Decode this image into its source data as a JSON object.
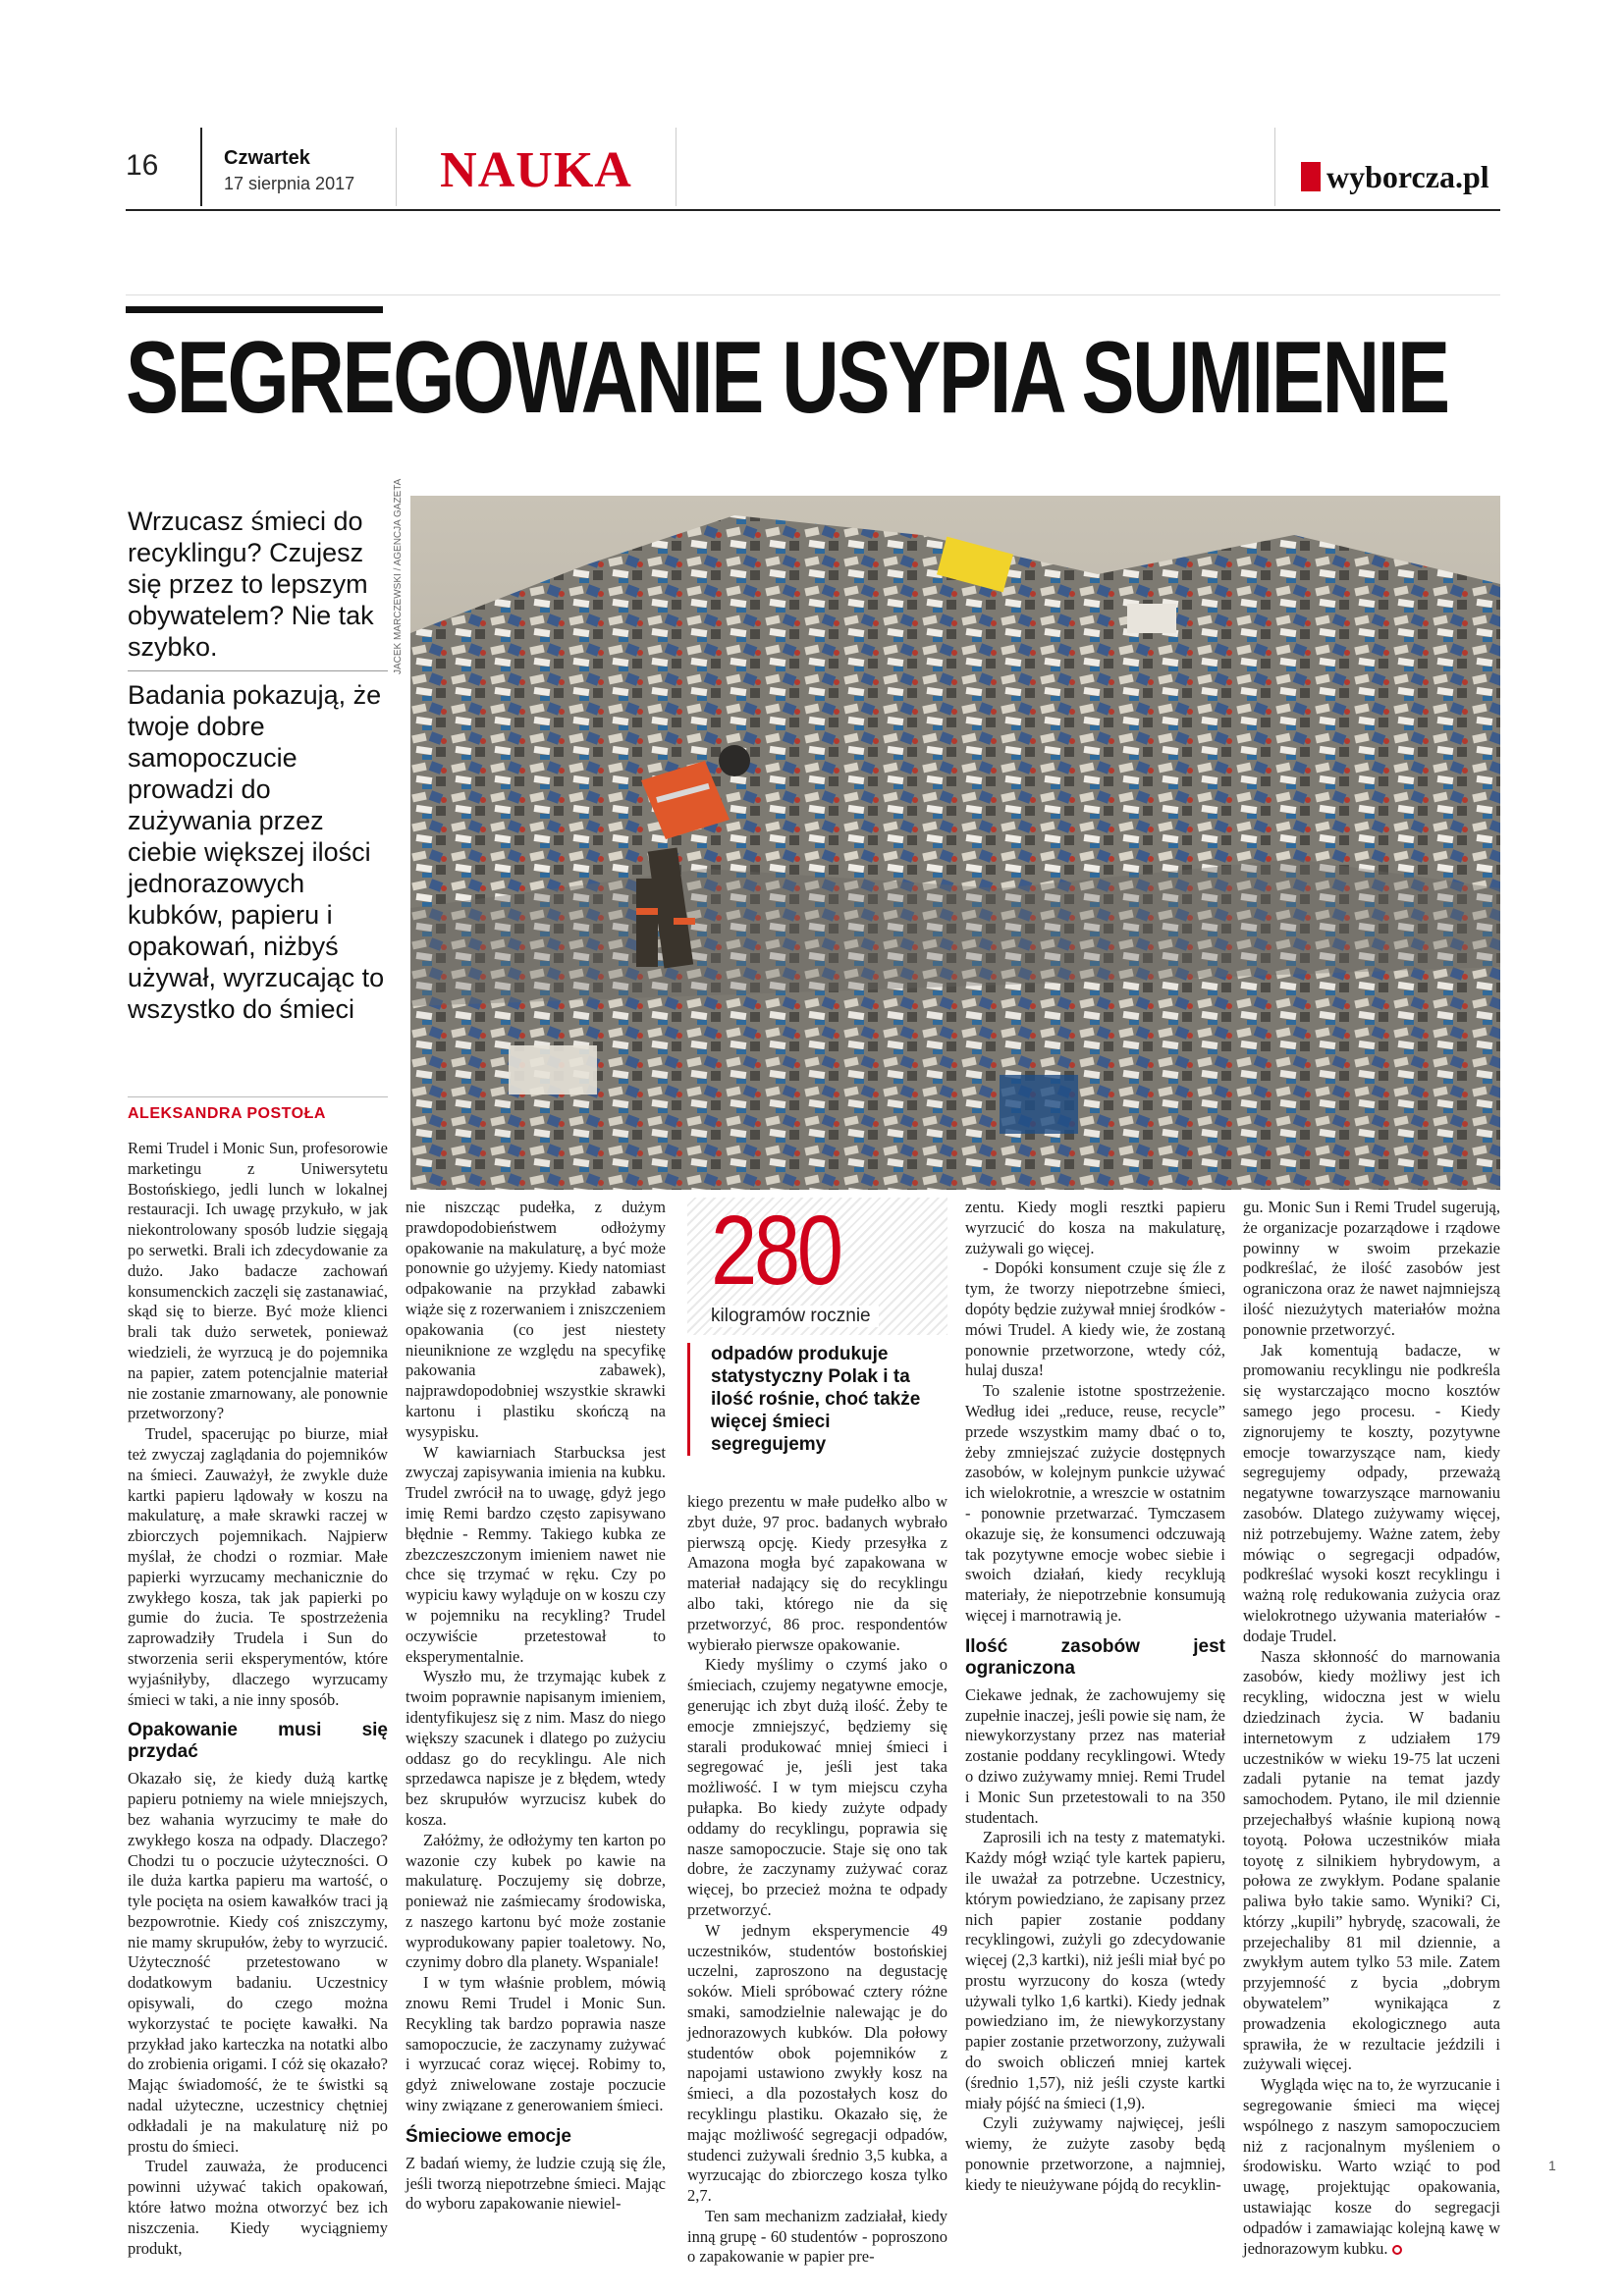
{
  "header": {
    "page_number": "16",
    "day": "Czwartek",
    "date": "17 sierpnia 2017",
    "section": "NAUKA",
    "brand": "wyborcza.pl"
  },
  "headline": "SEGREGOWANIE USYPIA SUMIENIE",
  "lead": {
    "intro": "Wrzucasz śmieci do recyklingu? Czujesz się przez to lepszym obywatelem? Nie tak szybko.",
    "body": "Badania pokazują, że twoje dobre samopoczucie prowadzi do zużywania przez ciebie większej ilości jednorazowych kubków, papieru i opakowań, niżbyś używał, wyrzucając to wszystko do śmieci"
  },
  "photo_credit": "JACEK MARCZEWSKI / AGENCJA GAZETA",
  "author": "ALEKSANDRA POSTOŁA",
  "fact": {
    "number": "280",
    "unit": "kilogramów rocznie",
    "description": "odpadów produkuje statystyczny Polak i ta ilość rośnie, choć także więcej śmieci segregujemy"
  },
  "col1": {
    "p1": "Remi Trudel i Monic Sun, profesorowie marketingu z Uniwersytetu Bostońskiego, jedli lunch w lokalnej restauracji. Ich uwagę przykuło, w jak niekontrolowany sposób ludzie sięgają po serwetki. Brali ich zdecydowanie za dużo. Jako badacze zachowań konsumenckich zaczęli się zastanawiać, skąd się to bierze. Być może klienci brali tak dużo serwetek, ponieważ wiedzieli, że wyrzucą je do pojemnika na papier, zatem potencjalnie materiał nie zostanie zmarnowany, ale ponownie przetworzony?",
    "p2": "Trudel, spacerując po biurze, miał też zwyczaj zaglądania do pojemników na śmieci. Zauważył, że zwykle duże kartki papieru lądowały w koszu na makulaturę, a małe skrawki raczej w zbiorczych pojemnikach. Najpierw myślał, że chodzi o rozmiar. Małe papierki wyrzucamy mechanicznie do zwykłego kosza, tak jak papierki po gumie do żucia. Te spostrzeżenia zaprowadziły Trudela i Sun do stworzenia serii eksperymentów, które wyjaśniłyby, dlaczego wyrzucamy śmieci w taki, a nie inny sposób.",
    "h1": "Opakowanie musi się przydać",
    "p3": "Okazało się, że kiedy dużą kartkę papieru potniemy na wiele mniejszych, bez wahania wyrzucimy te małe do zwykłego kosza na odpady. Dlaczego? Chodzi tu o poczucie użyteczności. O ile duża kartka papieru ma wartość, o tyle pocięta na osiem kawałków traci ją bezpowrotnie. Kiedy coś zniszczymy, nie mamy skrupułów, żeby to wyrzucić. Użyteczność przetestowano w dodatkowym badaniu. Uczestnicy opisywali, do czego można wykorzystać te pocięte kawałki. Na przykład jako karteczka na notatki albo do zrobienia origami. I cóż się okazało? Mając świadomość, że te świstki są nadal użyteczne, uczestnicy chętniej odkładali je na makulaturę niż po prostu do śmieci.",
    "p4": "Trudel zauważa, że producenci powinni używać takich opakowań, które łatwo można otworzyć bez ich niszczenia. Kiedy wyciągniemy produkt,"
  },
  "col2": {
    "p1": "nie niszcząc pudełka, z dużym prawdopodobieństwem odłożymy opakowanie na makulaturę, a być może ponownie go użyjemy. Kiedy natomiast odpakowanie na przykład zabawki wiąże się z rozerwaniem i zniszczeniem opakowania (co jest niestety nieuniknione ze względu na specyfikę pakowania zabawek), najprawdopodobniej wszystkie skrawki kartonu i plastiku skończą na wysypisku.",
    "p2": "W kawiarniach Starbucksa jest zwyczaj zapisywania imienia na kubku. Trudel zwrócił na to uwagę, gdyż jego imię Remi bardzo często zapisywano błędnie - Remmy. Takiego kubka ze zbezczeszczonym imieniem nawet nie chce się trzymać w ręku. Czy po wypiciu kawy wyląduje on w koszu czy w pojemniku na recykling? Trudel oczywiście przetestował to eksperymentalnie.",
    "p3": "Wyszło mu, że trzymając kubek z twoim poprawnie napisanym imieniem, identyfikujesz się z nim. Masz do niego większy szacunek i dlatego po zużyciu oddasz go do recyklingu. Ale nich sprzedawca napisze je z błędem, wtedy bez skrupułów wyrzucisz kubek do kosza.",
    "p4": "Załóżmy, że odłożymy ten karton po wazonie czy kubek po kawie na makulaturę. Poczujemy się dobrze, ponieważ nie zaśmiecamy środowiska, z naszego kartonu być może zostanie wyprodukowany papier toaletowy. No, czynimy dobro dla planety. Wspaniale!",
    "p5": "I w tym właśnie problem, mówią znowu Remi Trudel i Monic Sun. Recykling tak bardzo poprawia nasze samopoczucie, że zaczynamy zużywać i wyrzucać coraz więcej. Robimy to, gdyż zniwelowane zostaje poczucie winy związane z generowaniem śmieci.",
    "h1": "Śmieciowe emocje",
    "p6": "Z badań wiemy, że ludzie czują się źle, jeśli tworzą niepotrzebne śmieci. Mając do wyboru zapakowanie niewiel-"
  },
  "col3": {
    "p1": "kiego prezentu w małe pudełko albo w zbyt duże, 97 proc. badanych wybrało pierwszą opcję. Kiedy przesyłka z Amazona mogła być zapakowana w materiał nadający się do recyklingu albo taki, którego nie da się przetworzyć, 86 proc. respondentów wybierało pierwsze opakowanie.",
    "p2": "Kiedy myślimy o czymś jako o śmieciach, czujemy negatywne emocje, generując ich zbyt dużą ilość. Żeby te emocje zmniejszyć, będziemy się starali produkować mniej śmieci i segregować je, jeśli jest taka możliwość. I w tym miejscu czyha pułapka. Bo kiedy zużyte odpady oddamy do recyklingu, poprawia się nasze samopoczucie. Staje się ono tak dobre, że zaczynamy zużywać coraz więcej, bo przecież można te odpady przetworzyć.",
    "p3": "W jednym eksperymencie 49 uczestników, studentów bostońskiej uczelni, zaproszono na degustację soków. Mieli spróbować cztery różne smaki, samodzielnie nalewając je do jednorazowych kubków. Dla połowy studentów obok pojemników z napojami ustawiono zwykły kosz na śmieci, a dla pozostałych kosz do recyklingu plastiku. Okazało się, że mając możliwość segregacji odpadów, studenci zużywali średnio 3,5 kubka, a wyrzucając do zbiorczego kosza tylko 2,7.",
    "p4": "Ten sam mechanizm zadziałał, kiedy inną grupę - 60 studentów - poproszono o zapakowanie w papier pre-"
  },
  "col4": {
    "p1": "zentu. Kiedy mogli resztki papieru wyrzucić do kosza na makulaturę, zużywali go więcej.",
    "p2": "- Dopóki konsument czuje się źle z tym, że tworzy niepotrzebne śmieci, dopóty będzie zużywał mniej środków - mówi Trudel. A kiedy wie, że zostaną ponownie przetworzone, wtedy cóż, hulaj dusza!",
    "p3": "To szalenie istotne spostrzeżenie. Według idei „reduce, reuse, recycle” przede wszystkim mamy dbać o to, żeby zmniejszać zużycie dostępnych zasobów, w kolejnym punkcie używać ich wielokrotnie, a wreszcie w ostatnim - ponownie przetwarzać. Tymczasem okazuje się, że konsumenci odczuwają tak pozytywne emocje wobec siebie i swoich działań, kiedy recyklują materiały, że niepotrzebnie konsumują więcej i marnotrawią je.",
    "h1": "Ilość zasobów jest ograniczona",
    "p4": "Ciekawe jednak, że zachowujemy się zupełnie inaczej, jeśli powie się nam, że niewykorzystany przez nas materiał zostanie poddany recyklingowi. Wtedy o dziwo zużywamy mniej. Remi Trudel i Monic Sun przetestowali to na 350 studentach.",
    "p5": "Zaprosili ich na testy z matematyki. Każdy mógł wziąć tyle kartek papieru, ile uważał za potrzebne. Uczestnicy, którym powiedziano, że zapisany przez nich papier zostanie poddany recyklingowi, zużyli go zdecydowanie więcej (2,3 kartki), niż jeśli miał być po prostu wyrzucony do kosza (wtedy używali tylko 1,6 kartki). Kiedy jednak powiedziano im, że niewykorzystany papier zostanie przetworzony, zużywali do swoich obliczeń mniej kartek (średnio 1,57), niż jeśli czyste kartki miały pójść na śmieci (1,9).",
    "p6": "Czyli zużywamy najwięcej, jeśli wiemy, że zużyte zasoby będą ponownie przetworzone, a najmniej, kiedy te nieużywane pójdą do recyklin-"
  },
  "col5": {
    "p1": "gu. Monic Sun i Remi Trudel sugerują, że organizacje pozarządowe i rządowe powinny w swoim przekazie podkreślać, że ilość zasobów jest ograniczona oraz że nawet najmniejszą ilość niezużytych materiałów można ponownie przetworzyć.",
    "p2": "Jak komentują badacze, w promowaniu recyklingu nie podkreśla się wystarczająco mocno kosztów samego jego procesu. - Kiedy zignorujemy te koszty, pozytywne emocje towarzyszące nam, kiedy segregujemy odpady, przeważą negatywne towarzyszące marnowaniu zasobów. Dlatego zużywamy więcej, niż potrzebujemy. Ważne zatem, żeby mówiąc o segregacji odpadów, podkreślać wysoki koszt recyklingu i ważną rolę redukowania zużycia oraz wielokrotnego używania materiałów - dodaje Trudel.",
    "p3": "Nasza skłonność do marnowania zasobów, kiedy możliwy jest ich recykling, widoczna jest w wielu dziedzinach życia. W badaniu internetowym z udziałem 179 uczestników w wieku 19-75 lat uczeni zadali pytanie na temat jazdy samochodem. Pytano, ile mil dziennie przejechałbyś właśnie kupioną nową toyotą. Połowa uczestników miała toyotę z silnikiem hybrydowym, a połowa ze zwykłym. Podane spalanie paliwa było takie samo. Wyniki? Ci, którzy „kupili” hybrydę, szacowali, że przejechaliby 81 mil dziennie, a zwykłym autem tylko 53 mile. Zatem przyjemność z bycia „dobrym obywatelem” wynikająca z prowadzenia ekologicznego auta sprawiła, że w rezultacie jeździli i zużywali więcej.",
    "p4": "Wygląda więc na to, że wyrzucanie i segregowanie śmieci ma więcej wspólnego z naszym samopoczuciem niż z racjonalnym myśleniem o środowisku. Warto wziąć to pod uwagę, projektując opakowania, ustawiając kosze do segregacji odpadów i zamawiając kolejną kawę w jednorazowym kubku."
  },
  "footer": {
    "folio": "1"
  },
  "colors": {
    "accent": "#d0021b",
    "text": "#1a1a1a"
  }
}
